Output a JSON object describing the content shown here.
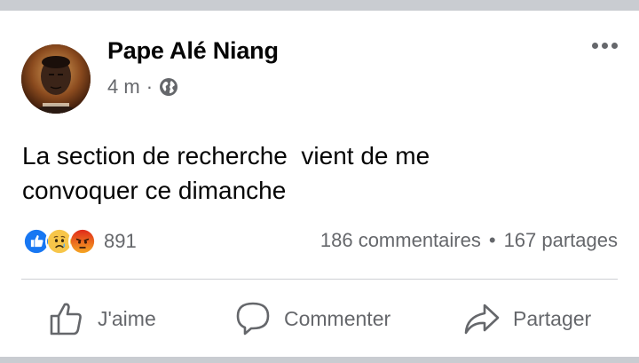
{
  "post": {
    "author": "Pape Alé Niang",
    "time": "4 m",
    "separator": "·",
    "visibility_icon": "globe-icon",
    "text": "La section de recherche  vient de me\nconvoquer ce dimanche"
  },
  "reactions": {
    "types": [
      "like",
      "sad",
      "angry"
    ],
    "count": "891"
  },
  "stats": {
    "comments": "186 commentaires",
    "separator": "•",
    "shares": "167 partages"
  },
  "actions": {
    "like": "J'aime",
    "comment": "Commenter",
    "share": "Partager"
  },
  "colors": {
    "like_blue": "#1877f2",
    "angry_red": "#e9710f",
    "secondary_text": "#65676b",
    "primary_text": "#050505"
  }
}
